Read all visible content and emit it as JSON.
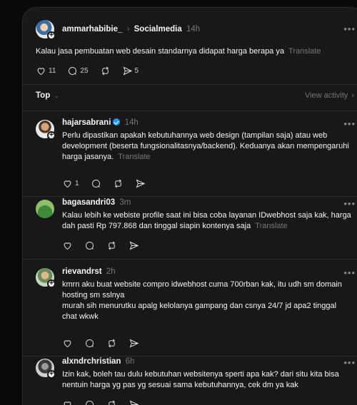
{
  "post": {
    "author": "ammarhabibie_",
    "community": "Socialmedia",
    "time": "14h",
    "text": "Kalau jasa pembuatan web desain standarnya didapat harga berapa ya",
    "translate": "Translate",
    "likes": "11",
    "replies": "25",
    "shares": "5"
  },
  "sort": {
    "label": "Top",
    "view_activity": "View activity"
  },
  "comments": [
    {
      "author": "hajarsabrani",
      "verified": true,
      "time": "14h",
      "text": "Perlu dipastikan apakah kebutuhannya web design (tampilan saja) atau web development (beserta fungsionalitasnya/backend). Keduanya akan mempengaruhi harga jasanya.",
      "translate": "Translate",
      "likes": "1"
    },
    {
      "author": "bagasandri03",
      "time": "3m",
      "text": "Kalau lebih ke webiste profile saat ini bisa coba layanan IDwebhost saja kak, harga dah pasti Rp 797.868 dan tinggal siapin kontenya saja",
      "translate": "Translate"
    },
    {
      "author": "rievandrst",
      "time": "2h",
      "text1": "kmrn aku buat website compro idwebhost cuma 700rban kak, itu udh sm domain hosting sm sslnya",
      "text2": "murah sih menurutku apalg kelolanya gampang dan csnya 24/7 jd apa2 tinggal chat wkwk"
    },
    {
      "author": "alxndrchristian",
      "time": "6h",
      "text": "Izin kak, boleh tau dulu kebutuhan websitenya sperti apa kak? dari situ kita bisa nentuin harga yg pas yg sesuai sama kebutuhannya, cek dm ya kak"
    }
  ],
  "icons": {
    "like": "heart-icon",
    "reply": "comment-icon",
    "repost": "repost-icon",
    "share": "send-icon",
    "more": "more-dots-icon"
  }
}
